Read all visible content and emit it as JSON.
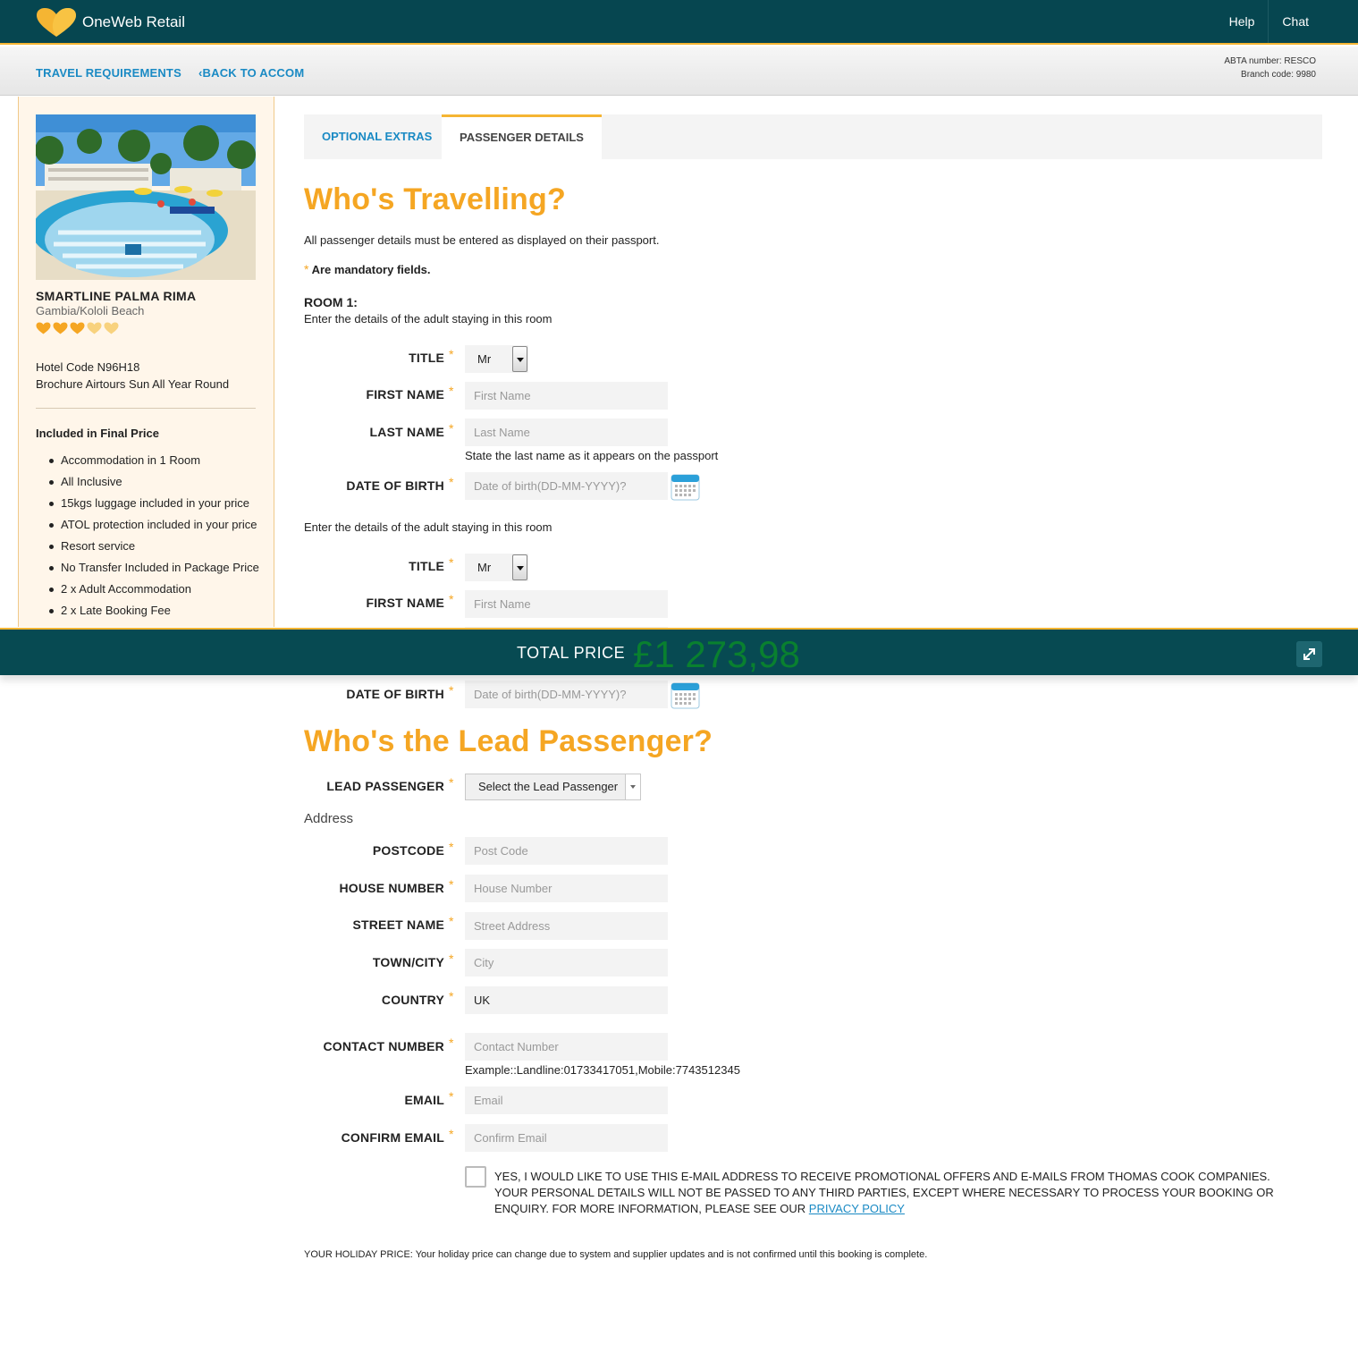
{
  "header": {
    "brand": "OneWeb Retail",
    "nav": [
      "Help",
      "Chat"
    ]
  },
  "subnav": {
    "travel_requirements": "TRAVEL REQUIREMENTS",
    "back_to_accom": "BACK TO ACCOM",
    "abta": "ABTA number: RESCO",
    "branch": "Branch code: 9980"
  },
  "hotel": {
    "name": "SMARTLINE PALMA RIMA",
    "location": "Gambia/Kololi Beach",
    "rating": 3,
    "rating_max": 5,
    "hotel_code": "Hotel Code N96H18",
    "brochure": "Brochure Airtours Sun All Year Round",
    "included_title": "Included in Final Price",
    "included": [
      "Accommodation in 1 Room",
      "All Inclusive",
      "15kgs luggage included in your price",
      "ATOL protection included in your price",
      "Resort service",
      "No Transfer Included in Package Price",
      "2 x Adult Accommodation",
      "2 x Late Booking Fee"
    ]
  },
  "tabs": {
    "optional_extras": "OPTIONAL EXTRAS",
    "passenger_details": "PASSENGER DETAILS"
  },
  "travelling": {
    "heading": "Who's Travelling?",
    "intro": "All passenger details must be entered as displayed on their passport.",
    "mandatory": "Are mandatory fields.",
    "room_label": "ROOM 1:",
    "adult_intro": "Enter the details of the adult staying in this room",
    "labels": {
      "title": "TITLE",
      "first_name": "FIRST NAME",
      "last_name": "LAST NAME",
      "dob": "DATE OF BIRTH"
    },
    "placeholders": {
      "first_name": "First Name",
      "last_name": "Last Name",
      "dob": "Date of birth(DD-MM-YYYY)?"
    },
    "last_name_hint": "State the last name as it appears on the passport",
    "adult1": {
      "title": "Mr"
    },
    "adult2": {
      "title": "Mr"
    }
  },
  "lead": {
    "heading": "Who's the Lead Passenger?",
    "label": "LEAD PASSENGER",
    "select_value": "Select the Lead Passenger",
    "address_label": "Address",
    "labels": {
      "postcode": "POSTCODE",
      "house_number": "HOUSE NUMBER",
      "street_name": "STREET NAME",
      "town": "TOWN/CITY",
      "country": "COUNTRY",
      "contact": "CONTACT NUMBER",
      "email": "EMAIL",
      "confirm_email": "CONFIRM EMAIL"
    },
    "placeholders": {
      "postcode": "Post Code",
      "house_number": "House Number",
      "street_name": "Street Address",
      "town": "City",
      "contact": "Contact Number",
      "email": "Email",
      "confirm_email": "Confirm Email"
    },
    "country_value": "UK",
    "contact_hint": "Example::Landline:01733417051,Mobile:7743512345",
    "optin_text": "Yes, I would like to use this e-mail address to receive promotional offers and e-mails from Thomas Cook companies. Your personal details will not be passed to any third parties, except where necessary to process your booking or enquiry. For more information, please see our ",
    "privacy_link": "Privacy Policy"
  },
  "disclaimer": "YOUR HOLIDAY PRICE: Your holiday price can change due to system and supplier updates and is not confirmed until this booking is complete.",
  "price_bar": {
    "label": "TOTAL PRICE",
    "amount": "£1 273,98"
  },
  "colors": {
    "header": "#064650",
    "accent": "#f5a623",
    "link": "#1a8ac4",
    "price": "#0a8a2a"
  }
}
